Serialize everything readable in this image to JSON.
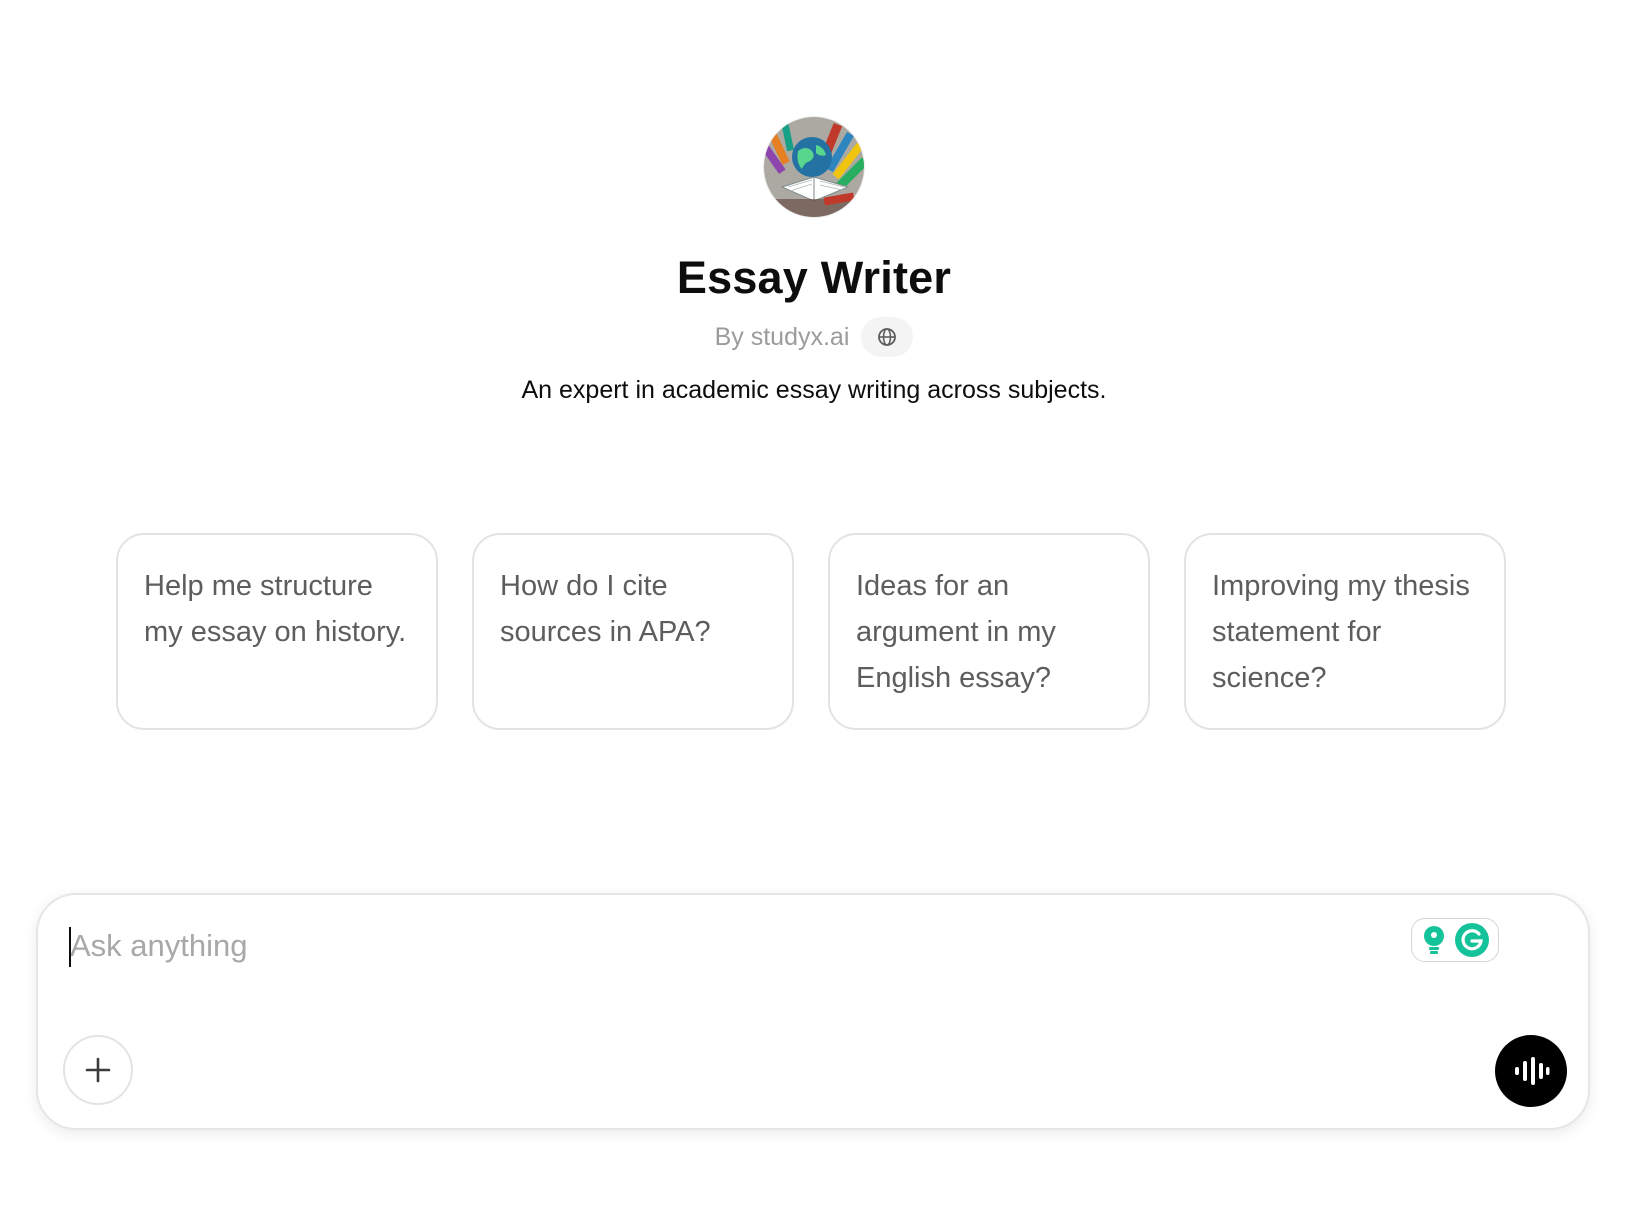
{
  "gpt": {
    "name": "Essay Writer",
    "byline": "By studyx.ai",
    "description": "An expert in academic essay writing across subjects."
  },
  "suggestions": [
    {
      "text": "Help me structure my essay on history."
    },
    {
      "text": "How do I cite sources in APA?"
    },
    {
      "text": "Ideas for an argument in my English essay?"
    },
    {
      "text": "Improving my thesis statement for science?"
    }
  ],
  "composer": {
    "placeholder": "Ask anything",
    "value": ""
  },
  "icons": {
    "avatar": "books-globe-illustration",
    "byline_icon": "globe-icon",
    "attach": "plus-icon",
    "voice": "voice-waveform-icon",
    "extension": "grammarly-icon"
  },
  "colors": {
    "title": "#0d0d0d",
    "muted": "#9b9b9b",
    "card_text": "#5d5d5d",
    "voice_button": "#000000",
    "grammarly": "#15c39a"
  }
}
